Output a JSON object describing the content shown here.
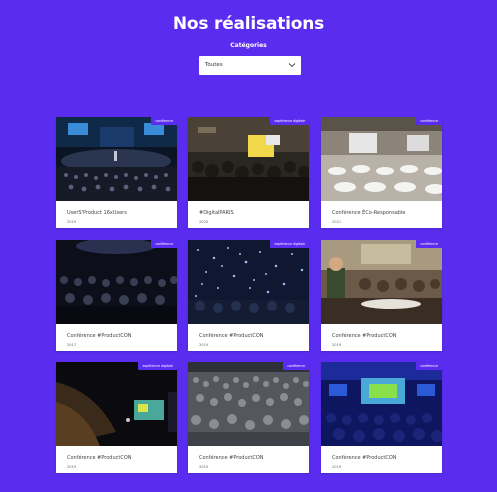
{
  "header": {
    "title": "Nos réalisations"
  },
  "filter": {
    "label": "Catégories",
    "selected": "Toutes"
  },
  "cards": [
    {
      "badge": "conférence",
      "title": "UserS'Product 16xUsers",
      "year": "2019"
    },
    {
      "badge": "expérience digitale",
      "title": "#DigitalPARIS",
      "year": "2020"
    },
    {
      "badge": "conférence",
      "title": "Conférence ÉCo-Responsable",
      "year": "2021"
    },
    {
      "badge": "conférence",
      "title": "Conférence #ProductCON",
      "year": "2017"
    },
    {
      "badge": "expérience digitale",
      "title": "Conférence #ProductCON",
      "year": "2019"
    },
    {
      "badge": "conférence",
      "title": "Conférence #ProductCON",
      "year": "2019"
    },
    {
      "badge": "expérience digitale",
      "title": "Conférence #ProductCON",
      "year": "2019"
    },
    {
      "badge": "conférence",
      "title": "Conférence #ProductCON",
      "year": "2019"
    },
    {
      "badge": "conférence",
      "title": "Conférence #ProductCON",
      "year": "2019"
    }
  ]
}
